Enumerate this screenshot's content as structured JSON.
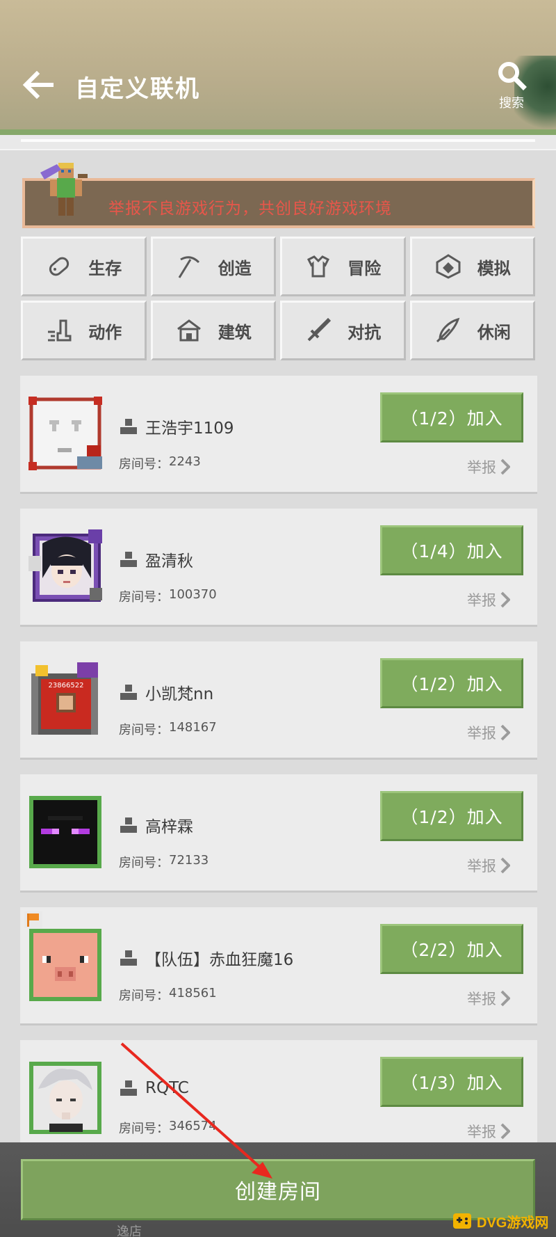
{
  "header": {
    "title": "自定义联机",
    "search_label": "搜索"
  },
  "notice": {
    "text": "举报不良游戏行为，共创良好游戏环境"
  },
  "categories": [
    {
      "label": "生存",
      "icon": "tag-icon"
    },
    {
      "label": "创造",
      "icon": "pickaxe-icon"
    },
    {
      "label": "冒险",
      "icon": "armor-icon"
    },
    {
      "label": "模拟",
      "icon": "cube-icon"
    },
    {
      "label": "动作",
      "icon": "boot-icon"
    },
    {
      "label": "建筑",
      "icon": "house-icon"
    },
    {
      "label": "对抗",
      "icon": "sword-icon"
    },
    {
      "label": "休闲",
      "icon": "feather-icon"
    }
  ],
  "room_id_prefix": "房间号：",
  "report_label": "举报",
  "join_label": "加入",
  "rooms": [
    {
      "owner": "王浩宇1109",
      "room_id": "2243",
      "occupancy": "（1/2）",
      "avatar": "ghast-face"
    },
    {
      "owner": "盈清秋",
      "room_id": "100370",
      "occupancy": "（1/4）",
      "avatar": "anime-girl"
    },
    {
      "owner": "小凯梵nn",
      "room_id": "148167",
      "occupancy": "（1/2）",
      "avatar": "framed-portrait",
      "avatar_text": "23866522"
    },
    {
      "owner": "高梓霖",
      "room_id": "72133",
      "occupancy": "（1/2）",
      "avatar": "enderman-face"
    },
    {
      "owner": "【队伍】赤血狂魔16",
      "room_id": "418561",
      "occupancy": "（2/2）",
      "avatar": "pig-face",
      "flag": true
    },
    {
      "owner": "RQTC",
      "room_id": "346574",
      "occupancy": "（1/3）",
      "avatar": "anime-boy"
    }
  ],
  "peek_owner": "逸店",
  "create_room_label": "创建房间",
  "watermark": {
    "text": "DVG游戏网"
  },
  "colors": {
    "accent_green": "#7fab5d",
    "notice_bg": "#7c6852",
    "notice_text": "#e8564a",
    "annotation_red": "#e8281f"
  }
}
